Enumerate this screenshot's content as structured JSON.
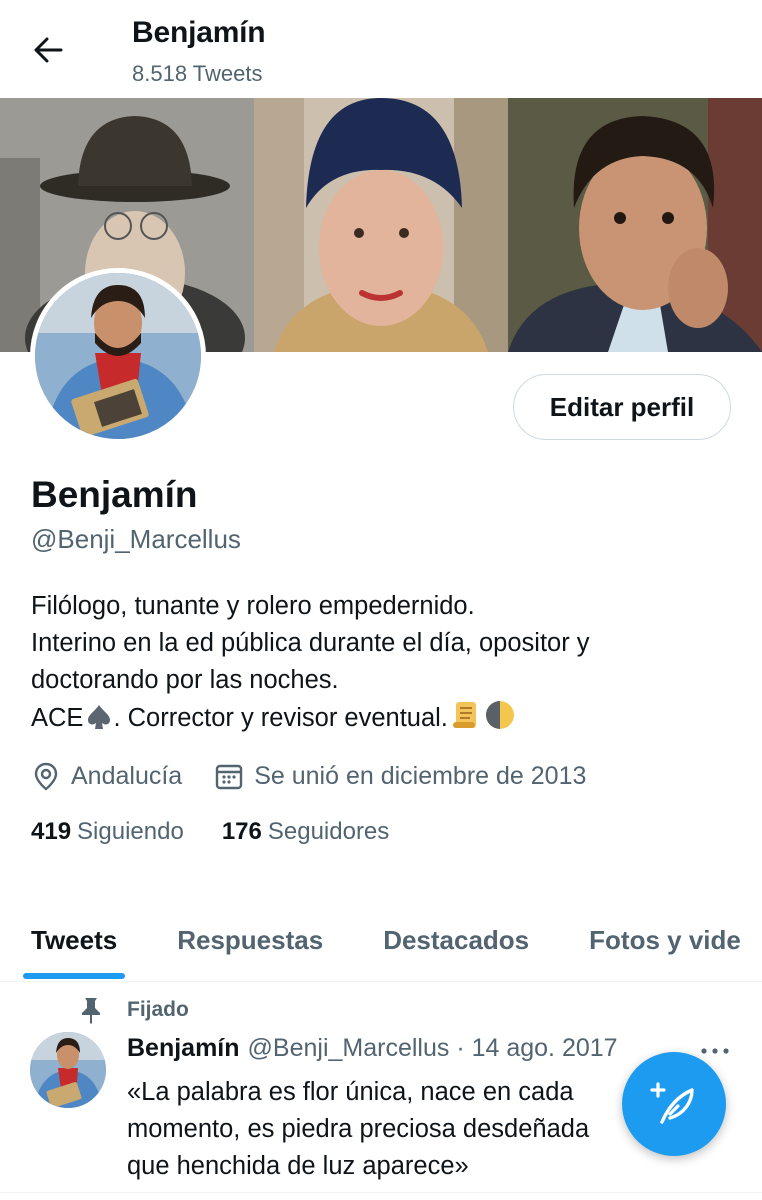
{
  "header": {
    "title": "Benjamín",
    "tweet_count": "8.518 Tweets"
  },
  "profile": {
    "edit_button": "Editar perfil",
    "name": "Benjamín",
    "handle": "@Benji_Marcellus",
    "bio_lines": [
      "Filólogo, tunante y rolero empedernido.",
      "Interino en la ed pública durante el día, opositor y",
      "doctorando por las noches.",
      "ACE",
      ". Corrector y revisor eventual."
    ],
    "location": "Andalucía",
    "joined": "Se unió en diciembre de 2013",
    "following_count": "419",
    "following_label": "Siguiendo",
    "followers_count": "176",
    "followers_label": "Seguidores"
  },
  "tabs": [
    "Tweets",
    "Respuestas",
    "Destacados",
    "Fotos y vide"
  ],
  "pinned_tweet": {
    "pinned_label": "Fijado",
    "author_name": "Benjamín",
    "author_meta": "@Benji_Marcellus · 14 ago. 2017",
    "text_lines": [
      "«La palabra es flor única, nace en cada",
      "momento, es piedra preciosa desdeñada",
      "que henchida de luz aparece»"
    ]
  },
  "icons": {
    "back": "arrow-left-icon",
    "location": "location-pin-icon",
    "calendar": "calendar-icon",
    "pin": "pin-icon",
    "more": "more-dots-icon",
    "compose": "compose-tweet-icon"
  },
  "colors": {
    "accent": "#1d9bf0",
    "text": "#0f1419",
    "secondary": "#536471",
    "border": "#cfd9de"
  }
}
